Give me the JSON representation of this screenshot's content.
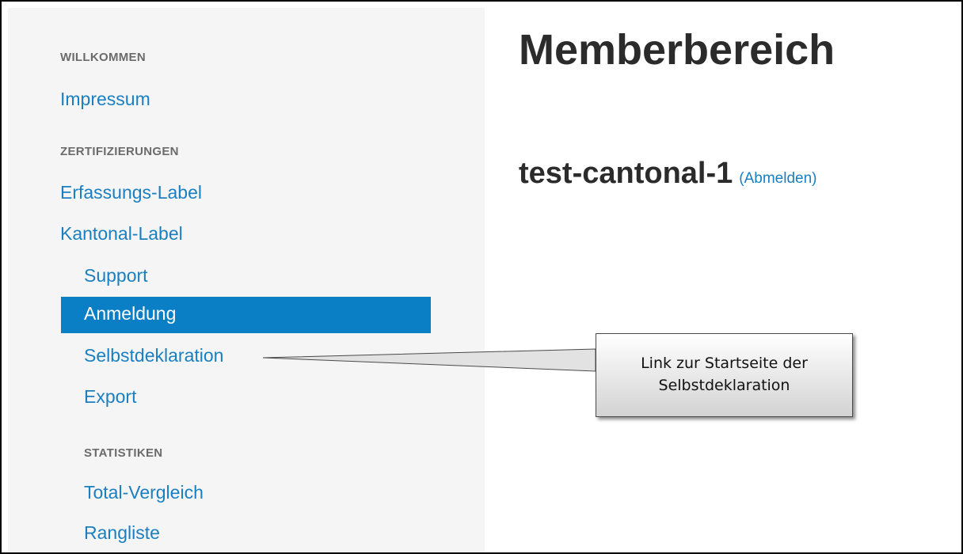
{
  "sidebar": {
    "sections": [
      {
        "header": "WILLKOMMEN",
        "items": [
          "Impressum"
        ]
      },
      {
        "header": "ZERTIFIZIERUNGEN",
        "items": [
          "Erfassungs-Label",
          "Kantonal-Label"
        ]
      }
    ],
    "subitems": [
      "Support",
      "Anmeldung",
      "Selbstdeklaration",
      "Export"
    ],
    "active_item": "Anmeldung",
    "statistics": {
      "header": "STATISTIKEN",
      "items": [
        "Total-Vergleich",
        "Rangliste"
      ]
    }
  },
  "main": {
    "title": "Memberbereich",
    "username": "test-cantonal-1",
    "logout_open": "(",
    "logout_label": "Abmelden",
    "logout_close": ")"
  },
  "callout": {
    "text": "Link zur Startseite der Selbstdeklaration"
  },
  "colors": {
    "link": "#1a7fc1",
    "active_bg": "#0a7fc5",
    "sidebar_bg": "#f5f5f5",
    "header_gray": "#6b6b6b"
  }
}
